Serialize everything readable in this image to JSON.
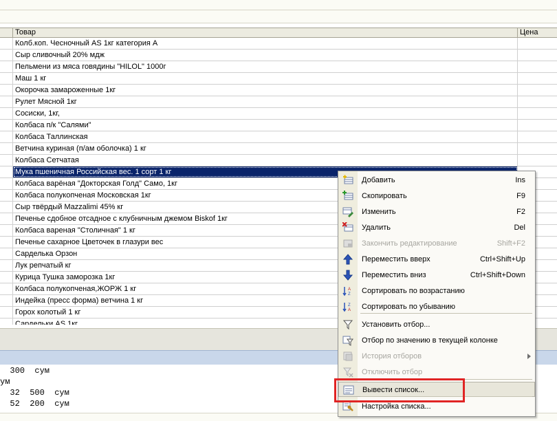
{
  "table": {
    "columns": {
      "name": "Товар",
      "price": "Цена"
    },
    "rows": [
      "Колб.коп. Чесночный AS 1кг категория А",
      "Сыр сливочный 20% мдж",
      "Пельмени из мяса говядины \"HILOL\" 1000г",
      "Маш 1 кг",
      "Окорочка замароженные 1кг",
      "Рулет Мясной 1кг",
      "Сосиски, 1кг,",
      "Колбаса п/к \"Салями\"",
      "Колбаса Таллинская",
      "Ветчина куриная (п/ам оболочка) 1 кг",
      "Колбаса Сетчатая",
      "Мука пшеничная Российская вес. 1 сорт 1 кг",
      "Колбаса варёная \"Докторская Голд\" Само, 1кг",
      "Колбаса полукопченая Московская 1кг",
      "Сыр твёрдый Mazzalimi 45% кг",
      "Печенье сдобное отсадное с клубничным джемом Biskof 1кг",
      "Колбаса вареная \"Столичная\" 1 кг",
      "Печенье сахарное Цветочек в глазури вес",
      "Сарделька Орзон",
      "Лук репчатый кг",
      "Курица Тушка заморозка 1кг",
      "Колбаса полукопченая,ЖОРЖ 1 кг",
      "Индейка (пресс форма) ветчина 1 кг",
      "Горох колотый 1 кг",
      "Сардельки AS 1кг"
    ],
    "selected_index": 11
  },
  "bottom_lines": [
    "  300  сум",
    "ум",
    "  32  500  сум",
    "  52  200  сум"
  ],
  "menu": {
    "items": [
      {
        "label": "Добавить",
        "shortcut": "Ins",
        "icon": "add-row-icon",
        "disabled": false
      },
      {
        "label": "Скопировать",
        "shortcut": "F9",
        "icon": "copy-row-icon",
        "disabled": false
      },
      {
        "label": "Изменить",
        "shortcut": "F2",
        "icon": "edit-row-icon",
        "disabled": false
      },
      {
        "label": "Удалить",
        "shortcut": "Del",
        "icon": "delete-row-icon",
        "disabled": false
      },
      {
        "label": "Закончить редактирование",
        "shortcut": "Shift+F2",
        "icon": "finish-edit-icon",
        "disabled": true
      },
      {
        "label": "Переместить вверх",
        "shortcut": "Ctrl+Shift+Up",
        "icon": "arrow-up-icon",
        "disabled": false
      },
      {
        "label": "Переместить вниз",
        "shortcut": "Ctrl+Shift+Down",
        "icon": "arrow-down-icon",
        "disabled": false
      },
      {
        "label": "Сортировать по возрастанию",
        "shortcut": "",
        "icon": "sort-asc-icon",
        "disabled": false
      },
      {
        "label": "Сортировать по убыванию",
        "shortcut": "",
        "icon": "sort-desc-icon",
        "disabled": false
      },
      {
        "label": "Установить отбор...",
        "shortcut": "",
        "icon": "filter-icon",
        "disabled": false
      },
      {
        "label": "Отбор по значению в текущей колонке",
        "shortcut": "",
        "icon": "filter-by-value-icon",
        "disabled": false
      },
      {
        "label": "История отборов",
        "shortcut": "",
        "icon": "filter-history-icon",
        "disabled": true
      },
      {
        "label": "Отключить отбор",
        "shortcut": "",
        "icon": "filter-off-icon",
        "disabled": true
      },
      {
        "label": "Вывести список...",
        "shortcut": "",
        "icon": "output-list-icon",
        "disabled": false
      },
      {
        "label": "Настройка списка...",
        "shortcut": "",
        "icon": "list-settings-icon",
        "disabled": false
      }
    ]
  },
  "colors": {
    "selection": "#0a246a",
    "highlight_box": "#e02424"
  }
}
